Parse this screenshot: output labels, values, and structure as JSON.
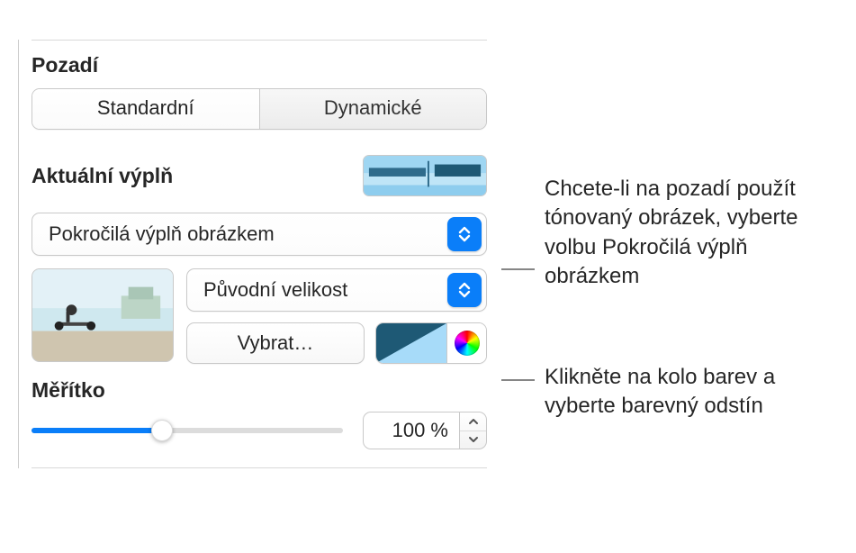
{
  "section_title": "Pozadí",
  "tabs": {
    "standard": "Standardní",
    "dynamic": "Dynamické"
  },
  "current_fill_label": "Aktuální výplň",
  "fill_type": "Pokročilá výplň obrázkem",
  "image_scaling": "Původní velikost",
  "choose_button": "Vybrat…",
  "scale": {
    "label": "Měřítko",
    "value_display": "100 %",
    "value": 100,
    "min": 0,
    "max": 250,
    "slider_percent": 42
  },
  "callouts": {
    "fill_type": "Chcete-li na pozadí použít tónovaný obrázek, vyberte volbu Pokročilá výplň obrázkem",
    "color_wheel": "Klikněte na kolo barev a vyberte barevný odstín"
  }
}
